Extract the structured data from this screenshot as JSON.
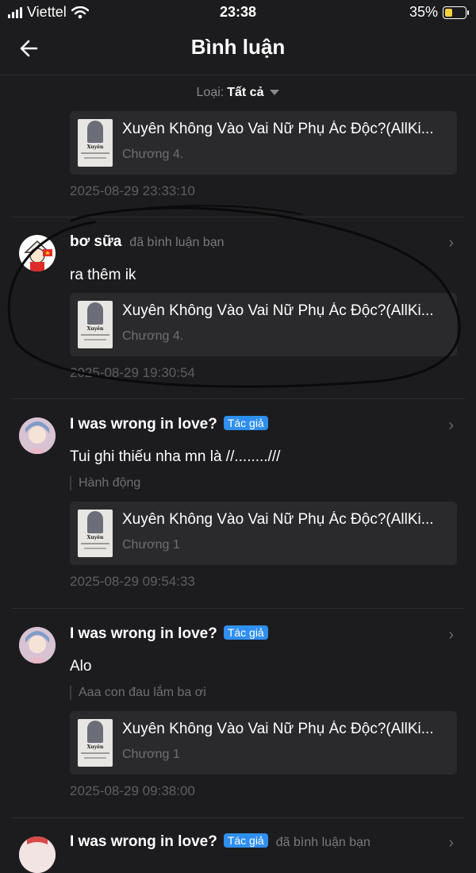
{
  "status": {
    "carrier": "Viettel",
    "time": "23:38",
    "battery": "35%",
    "battery_level": 0.35
  },
  "header": {
    "title": "Bình luận"
  },
  "filter": {
    "label": "Loại:",
    "value": "Tất cả"
  },
  "book": {
    "title": "Xuyên Không Vào Vai Nữ Phụ Ác Độc?(AllKi...",
    "cover_text": "Xuyên"
  },
  "items": [
    {
      "chapter": "Chương 4.",
      "date": "2025-08-29 23:33:10"
    },
    {
      "user": "bơ sữa",
      "action": "đã bình luận bạn",
      "comment": "ra thêm ik",
      "chapter": "Chương 4.",
      "date": "2025-08-29 19:30:54"
    },
    {
      "user": "I was wrong in love?",
      "badge": "Tác giả",
      "comment": "Tui ghi thiếu nha mn là //........///",
      "quote": "Hành động",
      "chapter": "Chương 1",
      "date": "2025-08-29 09:54:33"
    },
    {
      "user": "I was wrong in love?",
      "badge": "Tác giả",
      "comment": "Alo",
      "quote": "Aaa con đau lắm ba ơi",
      "chapter": "Chương 1",
      "date": "2025-08-29 09:38:00"
    },
    {
      "user": "I was wrong in love?",
      "badge": "Tác giả",
      "action": "đã bình luận bạn"
    }
  ]
}
